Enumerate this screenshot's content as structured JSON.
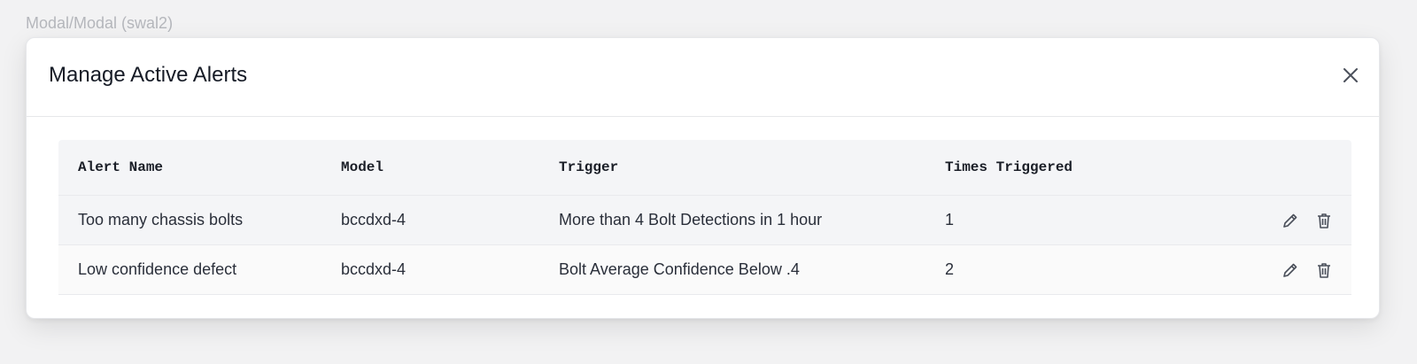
{
  "story_label": "Modal/Modal (swal2)",
  "modal": {
    "title": "Manage Active Alerts",
    "close_icon": "close-icon"
  },
  "table": {
    "headers": [
      "Alert Name",
      "Model",
      "Trigger",
      "Times Triggered"
    ],
    "rows": [
      {
        "name": "Too many chassis bolts",
        "model": "bccdxd-4",
        "trigger": "More than 4 Bolt Detections in 1 hour",
        "times": "1",
        "edit_icon": "pencil-icon",
        "delete_icon": "trash-icon"
      },
      {
        "name": "Low confidence defect",
        "model": "bccdxd-4",
        "trigger": "Bolt Average Confidence Below .4",
        "times": "2",
        "edit_icon": "pencil-icon",
        "delete_icon": "trash-icon"
      }
    ]
  },
  "colors": {
    "background": "#f2f2f3",
    "header_row": "#f4f5f7",
    "text": "#1f2430",
    "icon": "#4a4f5a"
  }
}
